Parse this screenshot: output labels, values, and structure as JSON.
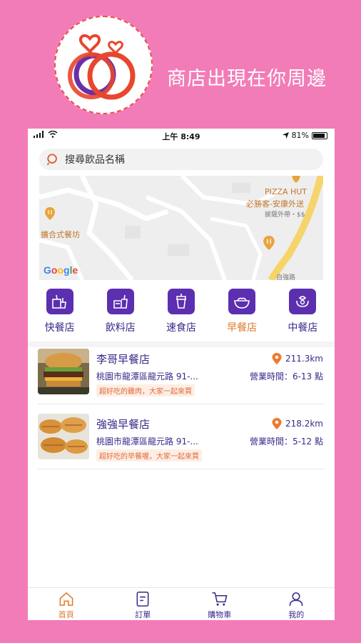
{
  "promo": {
    "tagline": "商店出現在你周邊"
  },
  "status_bar": {
    "time": "上午 8:49",
    "battery": "81%"
  },
  "search": {
    "placeholder": "搜尋飲品名稱"
  },
  "map": {
    "labels": {
      "pizza_hut": "PIZZA HUT",
      "pizza_hut_sub": "必勝客-安康外送",
      "pizza_hut_sub2": "披薩外帶・$$",
      "shop_left": "擴合式餐坊",
      "bottom_right": "自強路"
    },
    "attribution": "Google"
  },
  "categories": [
    {
      "label": "快餐店",
      "icon": "fastfood-icon"
    },
    {
      "label": "飲料店",
      "icon": "drink-icon"
    },
    {
      "label": "速食店",
      "icon": "cup-icon"
    },
    {
      "label": "早餐店",
      "icon": "bowl-icon",
      "active": true
    },
    {
      "label": "中餐店",
      "icon": "noodle-icon"
    }
  ],
  "stores": [
    {
      "name": "李哥早餐店",
      "distance": "211.3km",
      "address": "桃園市龍潭區龍元路 91-...",
      "hours": "營業時間：6-13 點",
      "tag": "超好吃的雞肉，大家一起來買"
    },
    {
      "name": "強強早餐店",
      "distance": "218.2km",
      "address": "桃園市龍潭區龍元路 91-...",
      "hours": "營業時間：5-12 點",
      "tag": "超好吃的早餐喔，大家一起來買"
    }
  ],
  "tabbar": [
    {
      "label": "首頁",
      "icon": "home-icon",
      "active": true
    },
    {
      "label": "訂單",
      "icon": "order-icon"
    },
    {
      "label": "購物車",
      "icon": "cart-icon"
    },
    {
      "label": "我的",
      "icon": "profile-icon"
    }
  ],
  "colors": {
    "background": "#f27cb8",
    "primary": "#5b2fb0",
    "accent": "#e07a2a",
    "text": "#3a2a8a"
  }
}
